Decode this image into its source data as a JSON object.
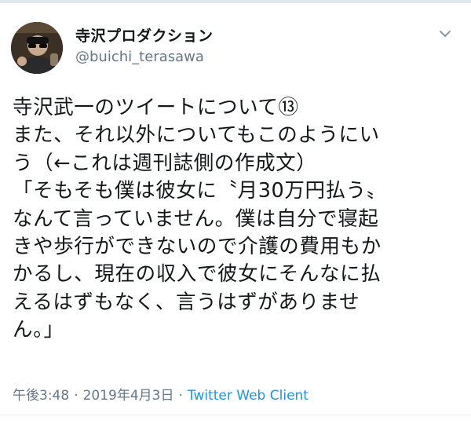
{
  "tweet": {
    "author": {
      "display_name": "寺沢プロダクション",
      "handle": "@buichi_terasawa",
      "avatar_icon": "profile-photo"
    },
    "menu_icon": "chevron-down-icon",
    "text_lines": [
      "寺沢武一のツイートについて⑬",
      "また、それ以外についてもこのようにい",
      "う（←これは週刊誌側の作成文）",
      "「そもそも僕は彼女に〝月30万円払う〟",
      "なんて言っていません。僕は自分で寝起",
      "きや歩行ができないので介護の費用もか",
      "かるし、現在の収入で彼女にそんなに払",
      "えるはずもなく、言うはずがありませ",
      "ん。」"
    ],
    "time": "午後3:48",
    "separator_1": "·",
    "date": "2019年4月3日",
    "separator_2": "·",
    "client": "Twitter Web Client"
  },
  "colors": {
    "text": "#14171a",
    "secondary": "#657786",
    "link": "#1b95e0"
  }
}
